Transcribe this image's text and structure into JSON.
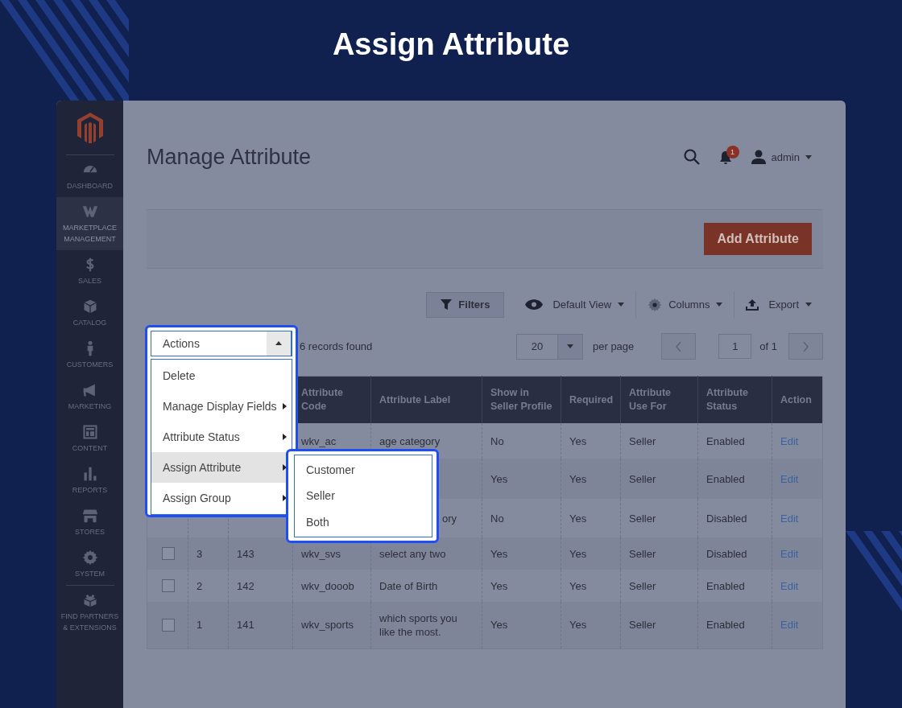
{
  "banner": {
    "title": "Assign Attribute"
  },
  "sidebar": {
    "items": [
      {
        "label": "DASHBOARD",
        "selected": false
      },
      {
        "label": "MARKETPLACE MANAGEMENT",
        "selected": true
      },
      {
        "label": "SALES",
        "selected": false
      },
      {
        "label": "CATALOG",
        "selected": false
      },
      {
        "label": "CUSTOMERS",
        "selected": false
      },
      {
        "label": "MARKETING",
        "selected": false
      },
      {
        "label": "CONTENT",
        "selected": false
      },
      {
        "label": "REPORTS",
        "selected": false
      },
      {
        "label": "STORES",
        "selected": false
      },
      {
        "label": "SYSTEM",
        "selected": false
      },
      {
        "label": "FIND PARTNERS & EXTENSIONS",
        "selected": false
      }
    ]
  },
  "header": {
    "title": "Manage Attribute",
    "notification_count": "1",
    "user": "admin"
  },
  "add_button": "Add Attribute",
  "toolbar": {
    "filters": "Filters",
    "view": "Default View",
    "columns": "Columns",
    "export": "Export"
  },
  "pager": {
    "records": "6 records found",
    "page_size": "20",
    "per_page": "per page",
    "page": "1",
    "of": "of 1"
  },
  "actions": {
    "label": "Actions",
    "expanded": true,
    "items": [
      {
        "label": "Delete",
        "submenu": false,
        "selected": false
      },
      {
        "label": "Manage Display Fields",
        "submenu": true,
        "selected": false
      },
      {
        "label": "Attribute Status",
        "submenu": true,
        "selected": false
      },
      {
        "label": "Assign Attribute",
        "submenu": true,
        "selected": true
      },
      {
        "label": "Assign Group",
        "submenu": true,
        "selected": false
      }
    ],
    "submenu": [
      "Customer",
      "Seller",
      "Both"
    ]
  },
  "table": {
    "columns": {
      "code": "Attribute Code",
      "label": "Attribute Label",
      "show": "Show in Seller Profile",
      "required": "Required",
      "use_for": "Attribute Use For",
      "status": "Attribute Status",
      "action": "Action"
    },
    "rows": [
      {
        "code": "wkv_ac",
        "label": "age category",
        "show": "No",
        "required": "Yes",
        "use_for": "Seller",
        "status": "Enabled",
        "action": "Edit"
      },
      {
        "show": "Yes",
        "required": "Yes",
        "use_for": "Seller",
        "status": "Enabled",
        "action": "Edit"
      },
      {
        "label": "ory",
        "label_clipped": true,
        "show": "No",
        "required": "Yes",
        "use_for": "Seller",
        "status": "Disabled",
        "action": "Edit"
      },
      {
        "checked": false,
        "number": "3",
        "id": "143",
        "code": "wkv_svs",
        "label": "select any two",
        "show": "Yes",
        "required": "Yes",
        "use_for": "Seller",
        "status": "Disabled",
        "action": "Edit"
      },
      {
        "checked": false,
        "number": "2",
        "id": "142",
        "code": "wkv_dooob",
        "label": "Date of Birth",
        "show": "Yes",
        "required": "Yes",
        "use_for": "Seller",
        "status": "Enabled",
        "action": "Edit"
      },
      {
        "checked": false,
        "number": "1",
        "id": "141",
        "code": "wkv_sports",
        "label": "which sports you like the most.",
        "show": "Yes",
        "required": "Yes",
        "use_for": "Seller",
        "status": "Enabled",
        "action": "Edit"
      }
    ]
  }
}
